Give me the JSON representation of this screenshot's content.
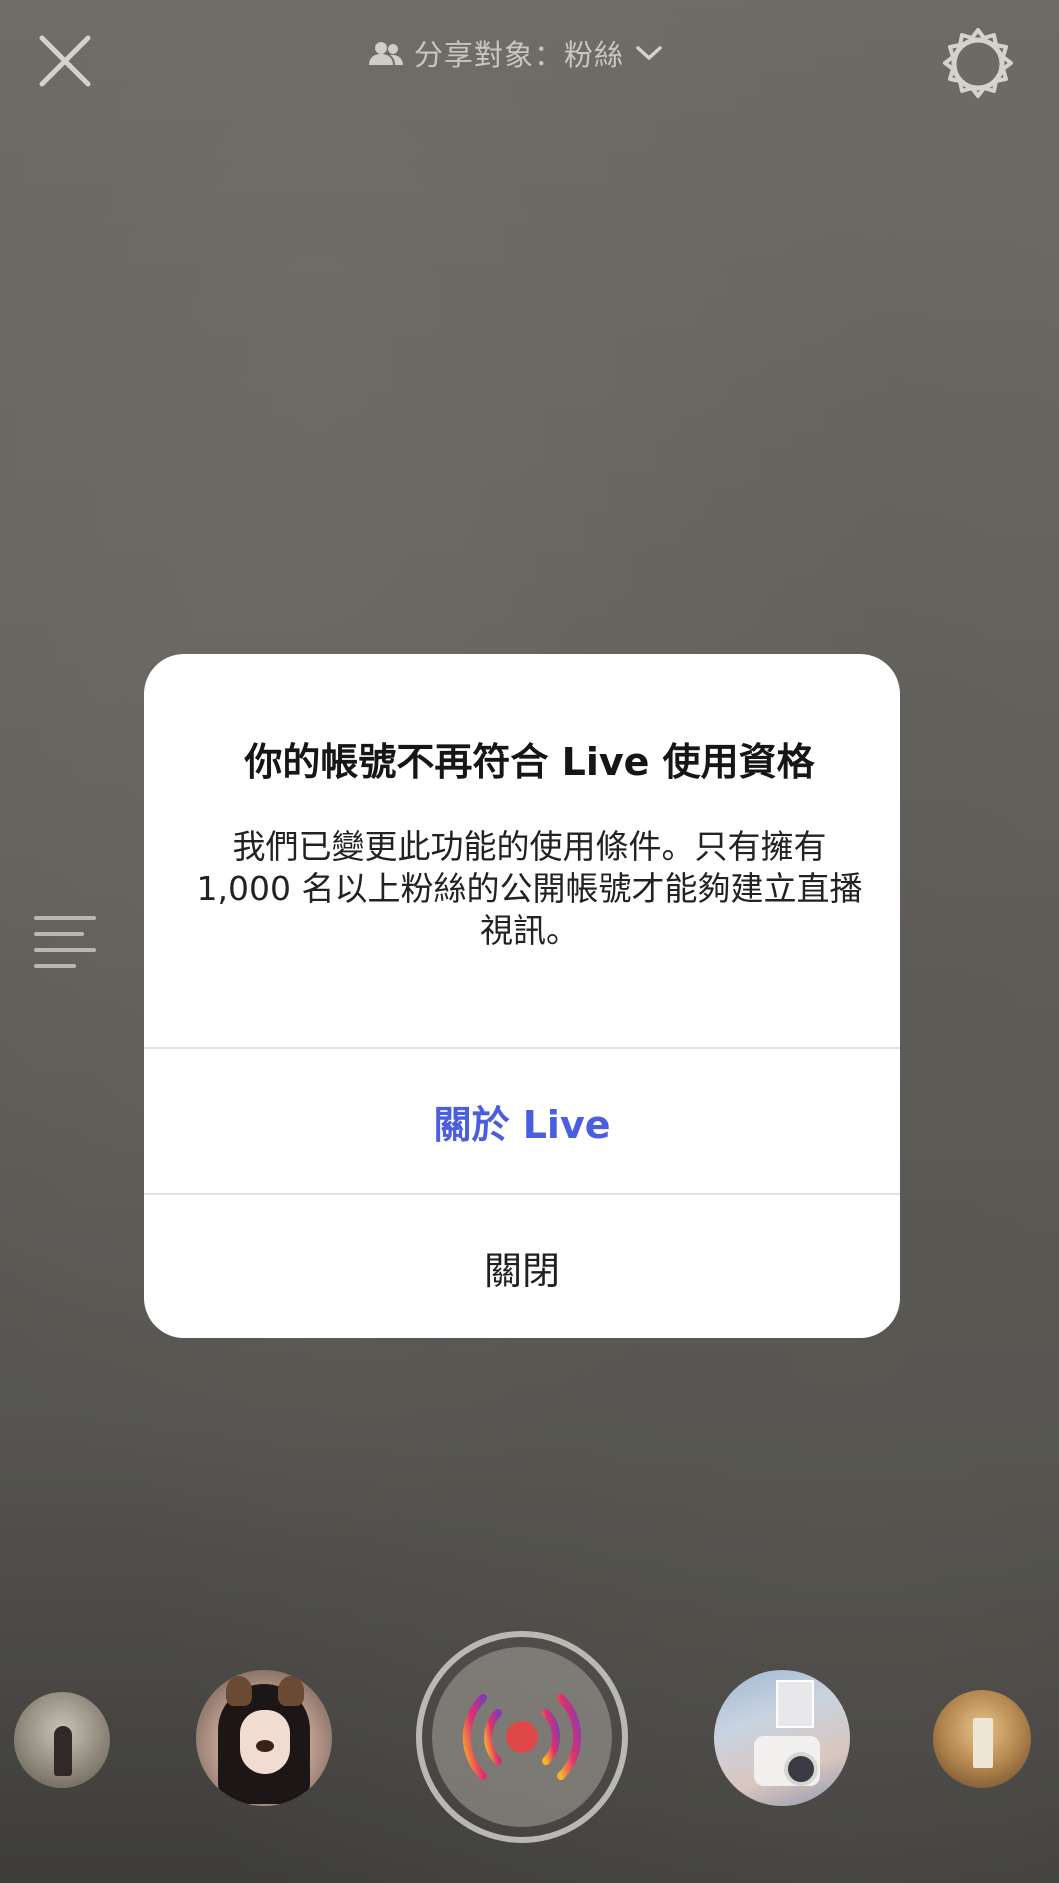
{
  "topbar": {
    "audience_label": "分享對象：粉絲",
    "close_icon": "close-icon",
    "settings_icon": "gear-icon",
    "people_icon": "people-icon",
    "chevron_icon": "chevron-down-icon"
  },
  "side": {
    "menu_icon": "menu-icon"
  },
  "dialog": {
    "title": "你的帳號不再符合 Live 使用資格",
    "message": "我們已變更此功能的使用條件。只有擁有 1,000 名以上粉絲的公開帳號才能夠建立直播視訊。",
    "primary_button": "關於 Live",
    "secondary_button": "關閉"
  },
  "bottom": {
    "live_icon": "live-broadcast-icon",
    "thumbnails": [
      "effect-thumbnail",
      "dog-filter-thumbnail",
      "camera-thumbnail",
      "sunset-thumbnail"
    ]
  },
  "colors": {
    "link_blue": "#4b5ee0",
    "live_gradient_start": "#f7b32b",
    "live_gradient_mid": "#e1306c",
    "live_gradient_end": "#833ab4"
  }
}
